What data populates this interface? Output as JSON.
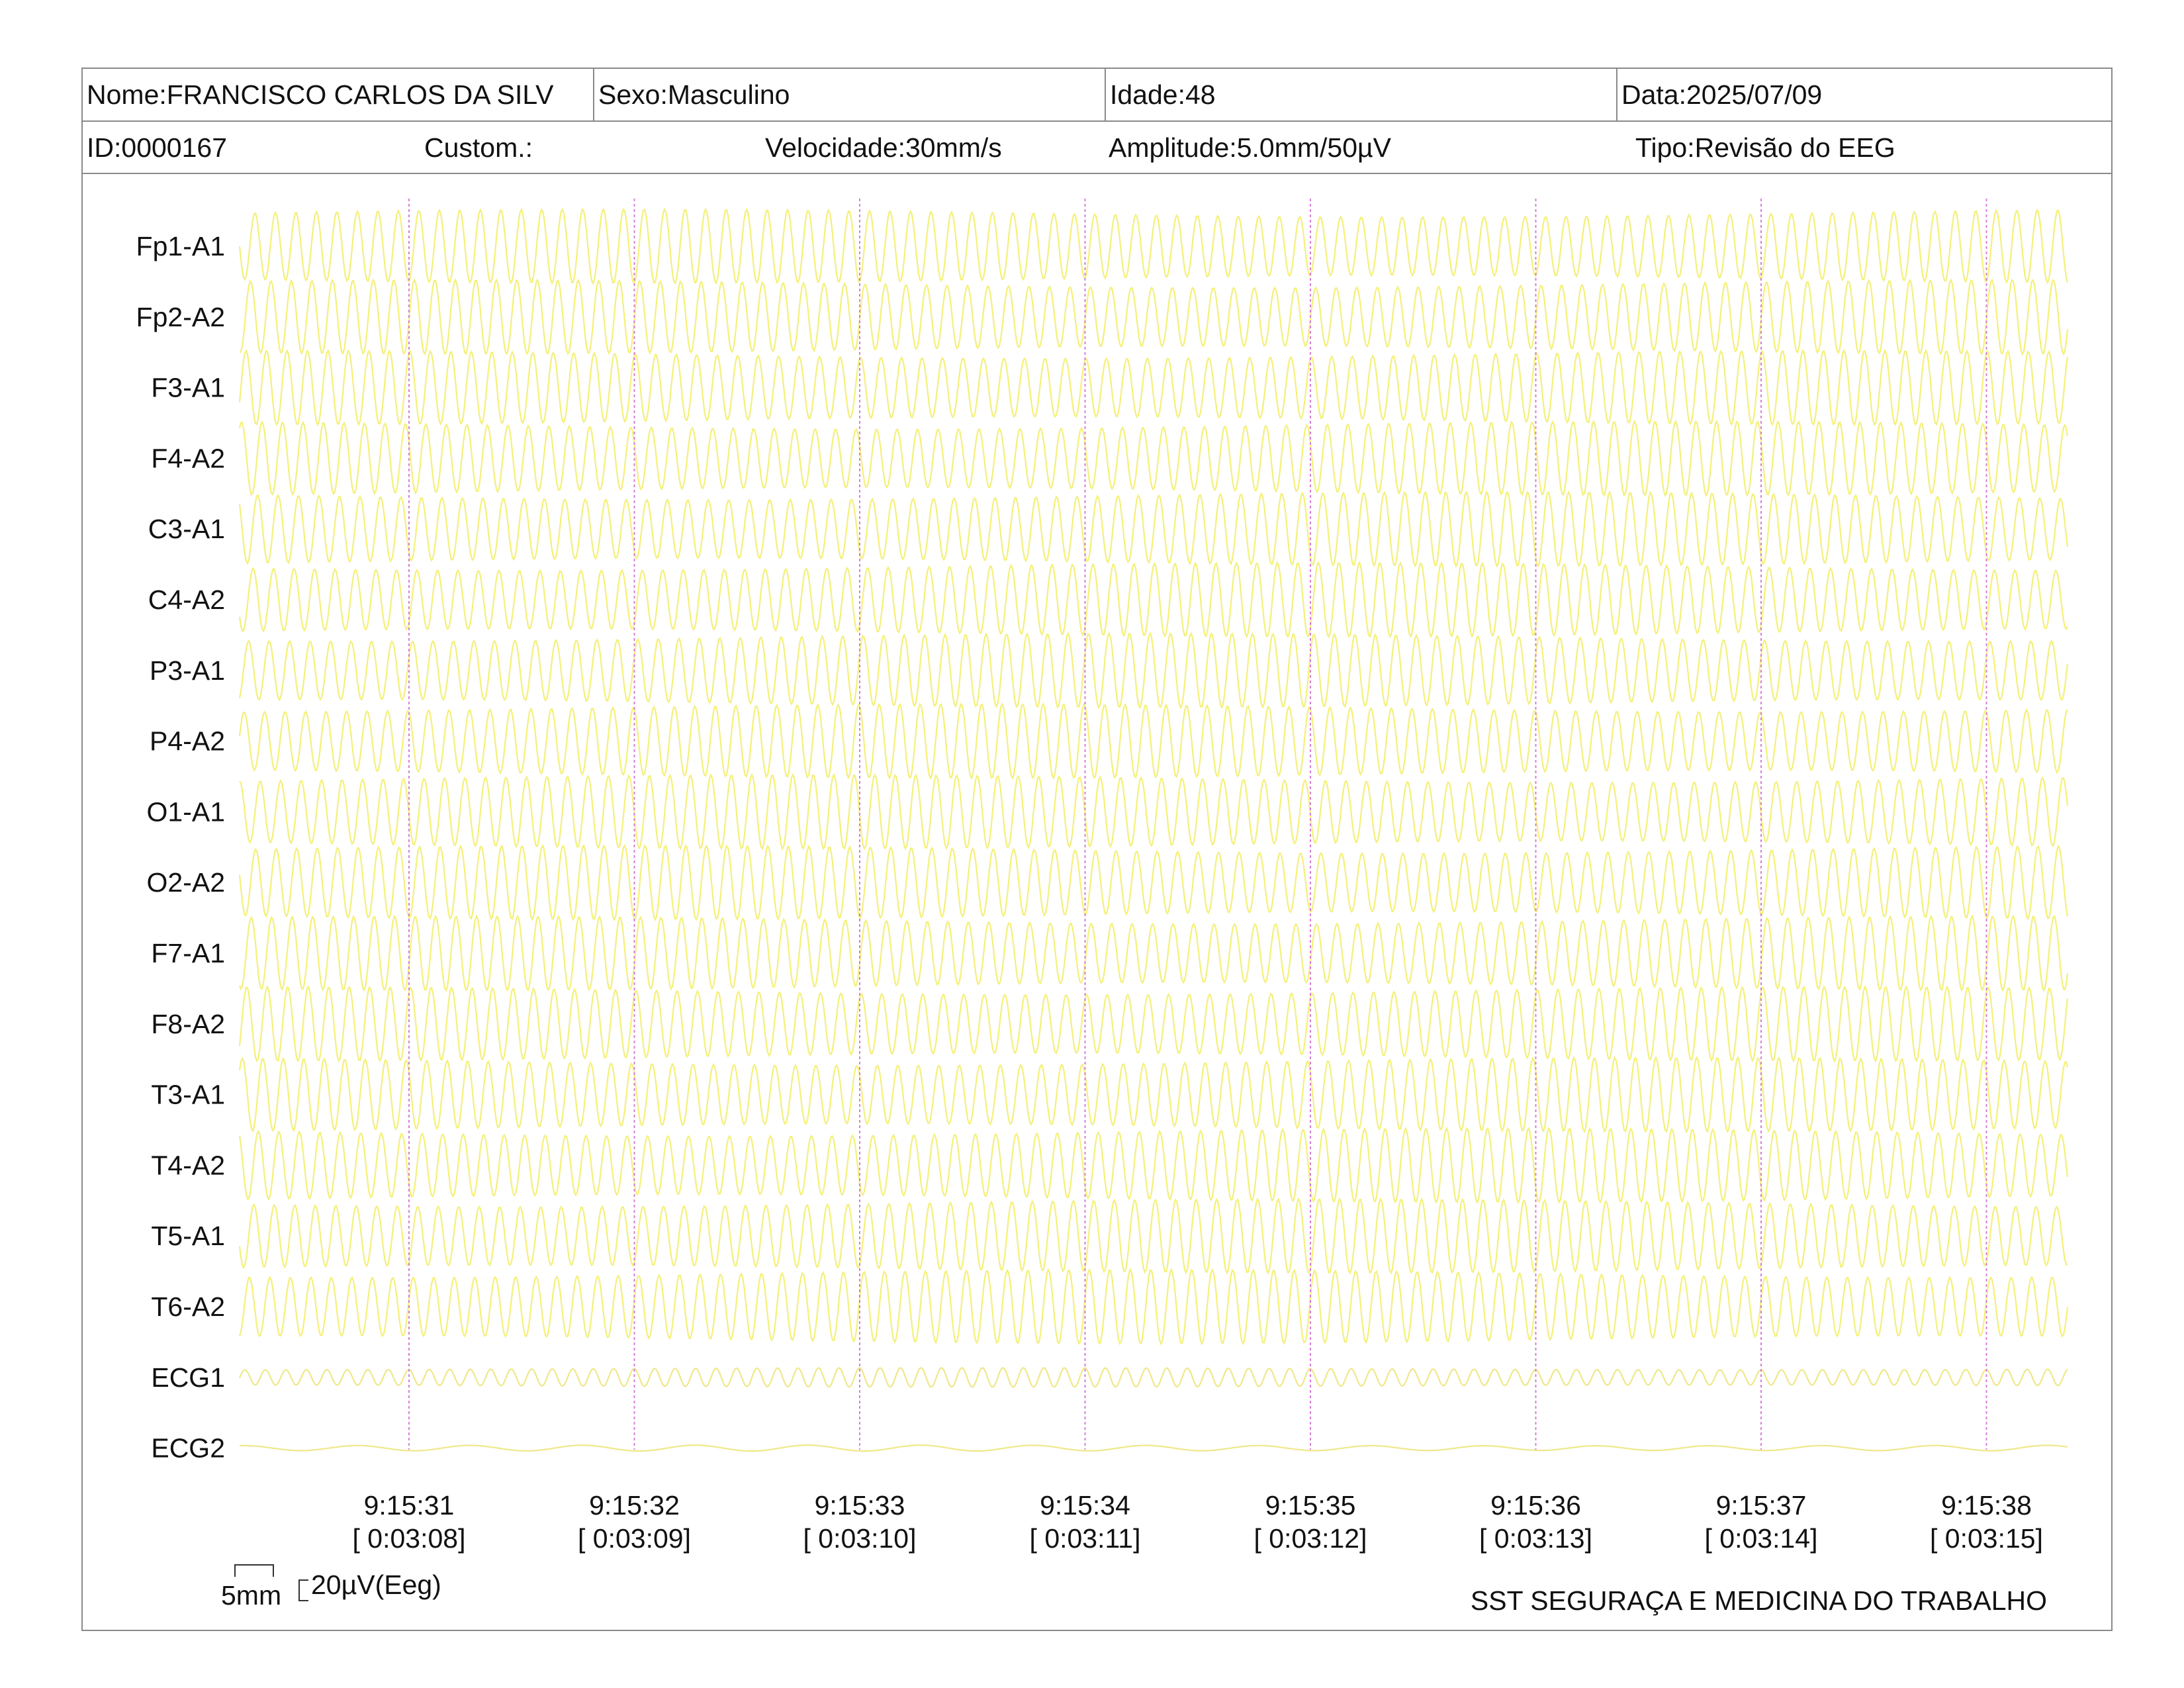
{
  "header": {
    "name": "Nome:FRANCISCO CARLOS DA SILV",
    "sex": "Sexo:Masculino",
    "age": "Idade:48",
    "date": "Data:2025/07/09",
    "id": "ID:0000167",
    "custom": "Custom.:",
    "speed": "Velocidade:30mm/s",
    "amplitude": "Amplitude:5.0mm/50µV",
    "type": "Tipo:Revisão do EEG"
  },
  "footer": {
    "scale_time": "5mm",
    "scale_amp": "20µV(Eeg)",
    "organization": "SST SEGURAÇA E MEDICINA DO TRABALHO"
  },
  "colors": {
    "trace": "#f4f07a",
    "ecg_trace": "#efe88a",
    "marker": "#d77cd9",
    "border": "#8a8a8a"
  },
  "chart_data": {
    "type": "line",
    "title": "",
    "xlabel": "",
    "ylabel": "",
    "channels": [
      "Fp1-A1",
      "Fp2-A2",
      "F3-A1",
      "F4-A2",
      "C3-A1",
      "C4-A2",
      "P3-A1",
      "P4-A2",
      "O1-A1",
      "O2-A2",
      "F7-A1",
      "F8-A2",
      "T3-A1",
      "T4-A2",
      "T5-A1",
      "T6-A2",
      "ECG1",
      "ECG2"
    ],
    "time_markers": [
      {
        "clock": "9:15:31",
        "elapsed": "[ 0:03:08]"
      },
      {
        "clock": "9:15:32",
        "elapsed": "[ 0:03:09]"
      },
      {
        "clock": "9:15:33",
        "elapsed": "[ 0:03:10]"
      },
      {
        "clock": "9:15:34",
        "elapsed": "[ 0:03:11]"
      },
      {
        "clock": "9:15:35",
        "elapsed": "[ 0:03:12]"
      },
      {
        "clock": "9:15:36",
        "elapsed": "[ 0:03:13]"
      },
      {
        "clock": "9:15:37",
        "elapsed": "[ 0:03:14]"
      },
      {
        "clock": "9:15:38",
        "elapsed": "[ 0:03:15]"
      }
    ],
    "seconds_shown": 8.1,
    "eeg_frequency_hz": 11,
    "ecg1_frequency_hz": 11,
    "ecg2_frequency_hz": 2,
    "grid": false
  }
}
